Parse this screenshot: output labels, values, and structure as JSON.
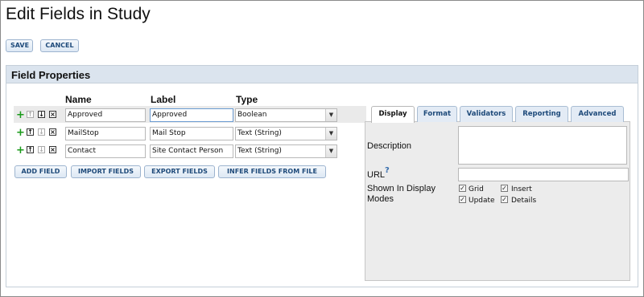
{
  "page": {
    "title": "Edit Fields in Study"
  },
  "toolbar": {
    "save_label": "SAVE",
    "cancel_label": "CANCEL"
  },
  "panel": {
    "title": "Field Properties"
  },
  "columns": {
    "name": "Name",
    "label": "Label",
    "type": "Type"
  },
  "fields": [
    {
      "name": "Approved",
      "label": "Approved",
      "type": "Boolean",
      "selected": true
    },
    {
      "name": "MailStop",
      "label": "Mail Stop",
      "type": "Text (String)",
      "selected": false
    },
    {
      "name": "Contact",
      "label": "Site Contact Person",
      "type": "Text (String)",
      "selected": false
    }
  ],
  "actions": {
    "add_field": "ADD FIELD",
    "import_fields": "IMPORT FIELDS",
    "export_fields": "EXPORT FIELDS",
    "infer_fields": "INFER FIELDS FROM FILE"
  },
  "tabs": [
    {
      "label": "Display",
      "active": true
    },
    {
      "label": "Format",
      "active": false
    },
    {
      "label": "Validators",
      "active": false
    },
    {
      "label": "Reporting",
      "active": false
    },
    {
      "label": "Advanced",
      "active": false
    }
  ],
  "properties": {
    "description_label": "Description",
    "description_value": "",
    "url_label": "URL",
    "url_help": "?",
    "url_value": "",
    "shown_in_label_line1": "Shown In Display",
    "shown_in_label_line2": "Modes",
    "modes": [
      {
        "label": "Grid",
        "checked": true
      },
      {
        "label": "Insert",
        "checked": true
      },
      {
        "label": "Update",
        "checked": true
      },
      {
        "label": "Details",
        "checked": true
      }
    ]
  },
  "icons": {
    "add": "plus-icon",
    "move_up": "arrow-up-icon",
    "move_down": "arrow-down-icon",
    "delete": "close-icon",
    "dropdown": "chevron-down-icon",
    "check": "checkmark-icon"
  },
  "colors": {
    "accent": "#1e4a7a",
    "add_green": "#1a9a1a",
    "header_bg": "#dbe4ee",
    "row_highlight": "#eaeaea"
  }
}
